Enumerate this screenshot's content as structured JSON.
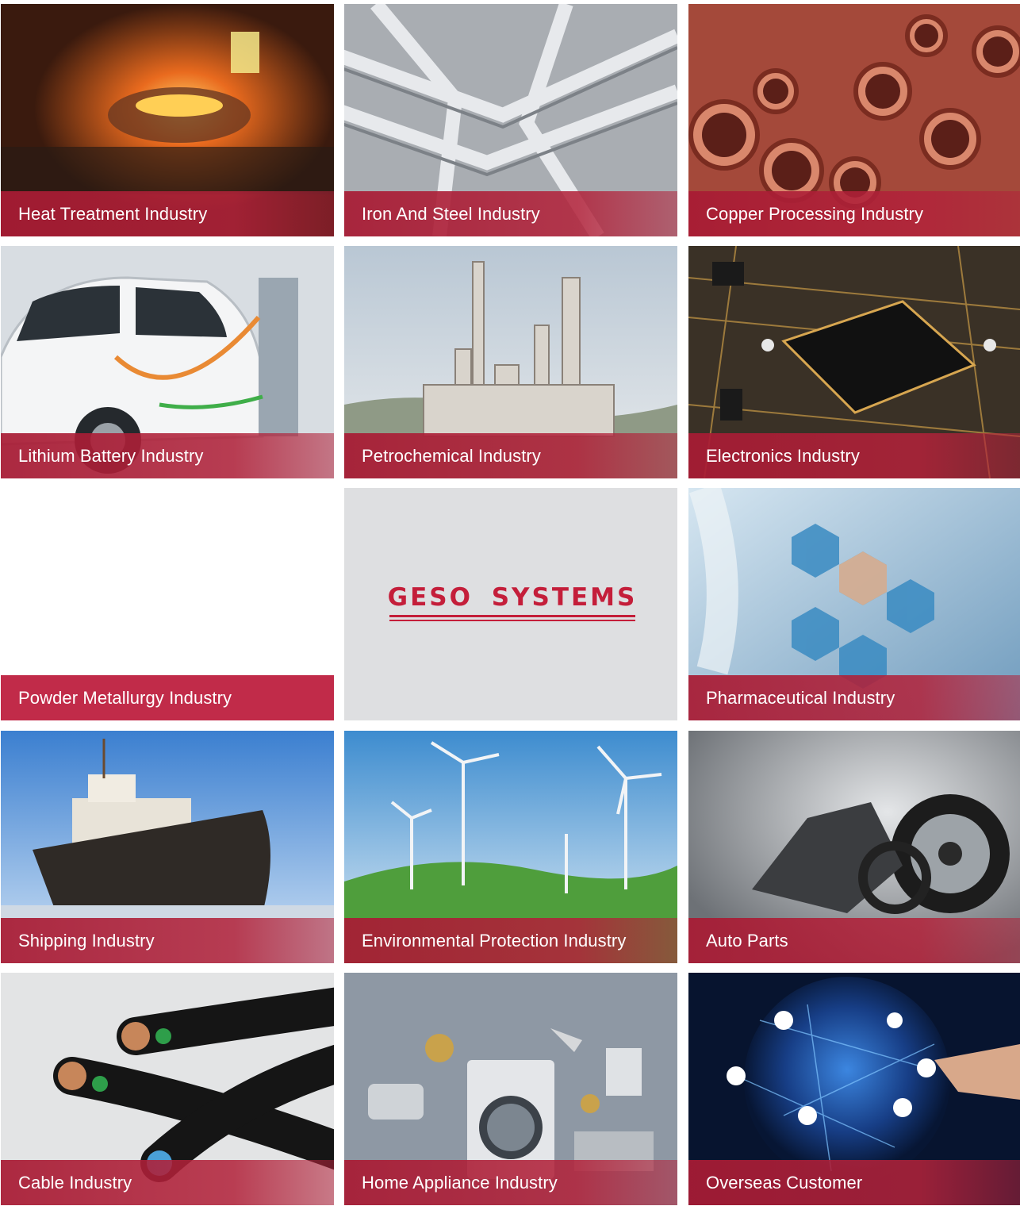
{
  "brand": {
    "logo_text": "GESO SYSTEMS",
    "accent": "#c41e3a"
  },
  "tiles": [
    {
      "label": "Heat Treatment Industry",
      "icon": "furnace-photo"
    },
    {
      "label": "Iron And Steel Industry",
      "icon": "steel-angles-photo"
    },
    {
      "label": "Copper Processing Industry",
      "icon": "copper-pipes-photo"
    },
    {
      "label": "Lithium Battery Industry",
      "icon": "electric-car-photo"
    },
    {
      "label": "Petrochemical Industry",
      "icon": "refinery-photo"
    },
    {
      "label": "Electronics Industry",
      "icon": "circuit-board-photo"
    },
    {
      "label": "Powder Metallurgy Industry",
      "icon": "blank-image"
    },
    {
      "label": "Pharmaceutical Industry",
      "icon": "medical-hexagons-photo"
    },
    {
      "label": "Shipping Industry",
      "icon": "ship-photo"
    },
    {
      "label": "Environmental Protection Industry",
      "icon": "wind-turbines-photo"
    },
    {
      "label": "Auto Parts",
      "icon": "auto-parts-photo"
    },
    {
      "label": "Cable Industry",
      "icon": "cables-photo"
    },
    {
      "label": "Home Appliance Industry",
      "icon": "appliances-photo"
    },
    {
      "label": "Overseas Customer",
      "icon": "globe-network-photo"
    }
  ]
}
